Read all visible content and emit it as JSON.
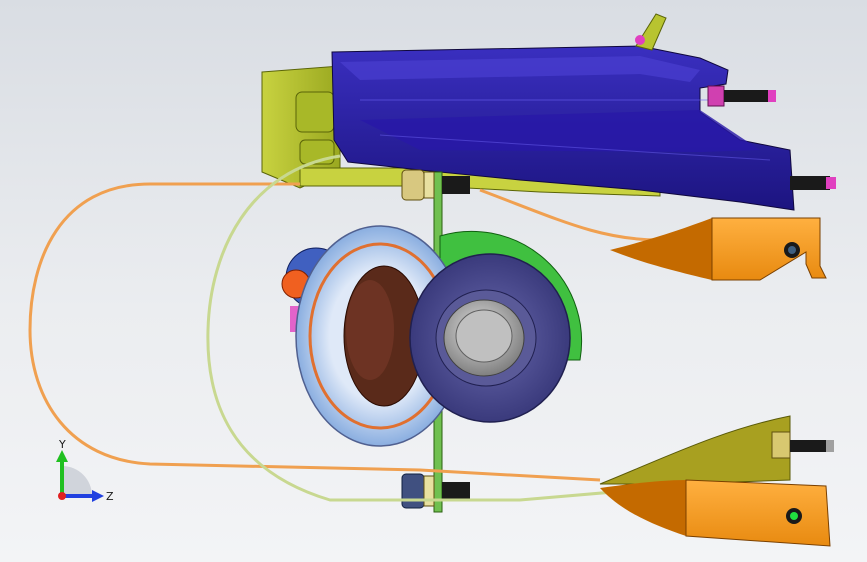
{
  "viewport": {
    "colors": {
      "bracket_navy": "#2a1fa0",
      "bracket_navy_light": "#4a3fd0",
      "mount_olive": "#b8c430",
      "mount_olive_dark": "#8c9a18",
      "arm_orange": "#f59a1e",
      "arm_orange_dark": "#c46a00",
      "cable_orange": "#f0a050",
      "cable_yellow": "#d8e8a0",
      "hub_blue": "#a8c8f0",
      "hub_ring": "#e07030",
      "pulley_navy": "#4a4a8c",
      "hub_core": "#b0b0b0",
      "shaft_brown": "#5a2a1a",
      "bolt_black": "#1a1a1a",
      "bolt_magenta": "#e040c0",
      "knob_orange": "#f06020",
      "green_flange": "#40c040"
    }
  },
  "triad": {
    "y_label": "Y",
    "z_label": "Z",
    "colors": {
      "y": "#20c020",
      "z": "#2040e0",
      "x": "#e02020"
    }
  }
}
